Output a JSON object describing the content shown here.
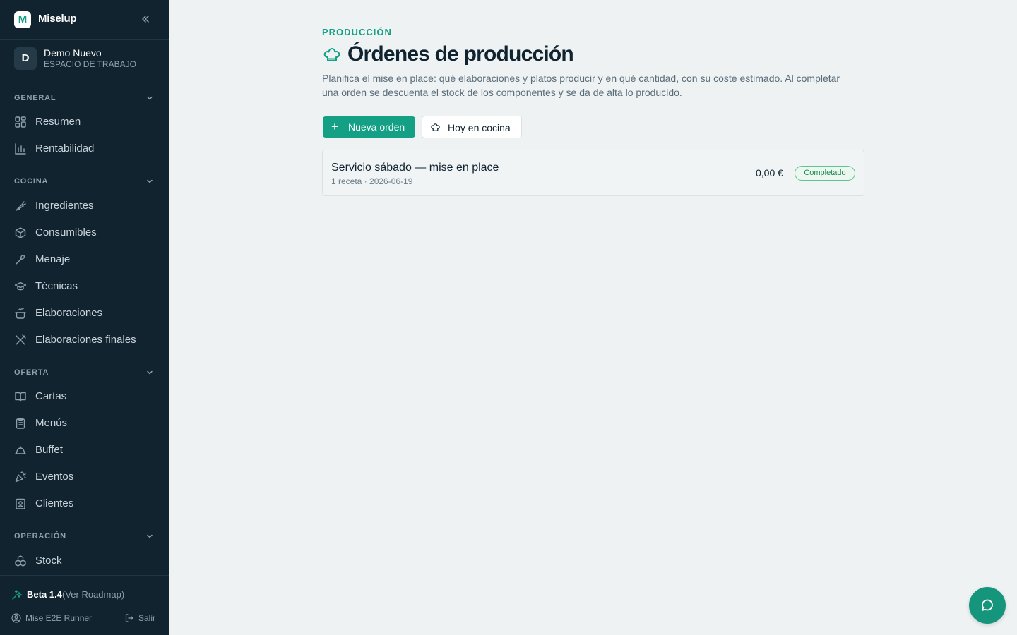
{
  "app": {
    "name": "Miselup",
    "logo_letter": "M"
  },
  "workspace": {
    "avatar_letter": "D",
    "name": "Demo Nuevo",
    "subtitle": "ESPACIO DE TRABAJO"
  },
  "sidebar": {
    "sections": [
      {
        "label": "GENERAL",
        "items": [
          {
            "label": "Resumen",
            "icon": "dashboard-icon"
          },
          {
            "label": "Rentabilidad",
            "icon": "bar-chart-icon"
          }
        ]
      },
      {
        "label": "COCINA",
        "items": [
          {
            "label": "Ingredientes",
            "icon": "carrot-icon"
          },
          {
            "label": "Consumibles",
            "icon": "box-icon"
          },
          {
            "label": "Menaje",
            "icon": "utensils-icon"
          },
          {
            "label": "Técnicas",
            "icon": "graduation-cap-icon"
          },
          {
            "label": "Elaboraciones",
            "icon": "cooking-pot-icon"
          },
          {
            "label": "Elaboraciones finales",
            "icon": "fork-knife-icon"
          }
        ]
      },
      {
        "label": "OFERTA",
        "items": [
          {
            "label": "Cartas",
            "icon": "book-open-icon"
          },
          {
            "label": "Menús",
            "icon": "clipboard-list-icon"
          },
          {
            "label": "Buffet",
            "icon": "cloche-icon"
          },
          {
            "label": "Eventos",
            "icon": "party-popper-icon"
          },
          {
            "label": "Clientes",
            "icon": "contact-icon"
          }
        ]
      },
      {
        "label": "OPERACIÓN",
        "items": [
          {
            "label": "Stock",
            "icon": "boxes-icon"
          }
        ]
      }
    ]
  },
  "footer": {
    "beta_label": "Beta 1.4",
    "roadmap_link": "(Ver Roadmap)",
    "user_name": "Mise E2E Runner",
    "logout_label": "Salir"
  },
  "page": {
    "eyebrow": "PRODUCCIÓN",
    "title": "Órdenes de producción",
    "description": "Planifica el mise en place: qué elaboraciones y platos producir y en qué cantidad, con su coste estimado. Al completar una orden se descuenta el stock de los componentes y se da de alta lo producido.",
    "actions": {
      "new_order_label": "Nueva orden",
      "today_label": "Hoy en cocina"
    }
  },
  "orders": [
    {
      "title": "Servicio sábado — mise en place",
      "meta": "1 receta · 2026-06-19",
      "price": "0,00 €",
      "status": "Completado"
    }
  ],
  "colors": {
    "accent": "#14a085",
    "sidebar_bg": "#10232f",
    "page_bg": "#eef2f3",
    "status_completed": "#20894f"
  }
}
